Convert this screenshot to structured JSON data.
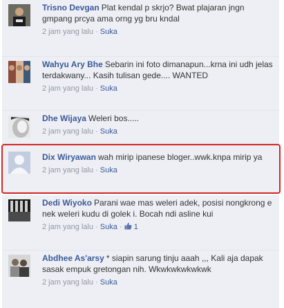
{
  "comments": [
    {
      "author": "Trisno Devgan",
      "text": "Plat kendal p skrjo? Bwat plajaran jngn gmpang prcya ama orng yg bru kndal",
      "time": "2 jam yang lalu",
      "separator": "·",
      "like_label": "Suka"
    },
    {
      "author": "Wahyu Ary Bhe",
      "text": "Sebarin ini foto dimanapun...krna ini udh jelas terdakwany... Kasih tulisan gede.... WANTED",
      "time": "2 jam yang lalu",
      "separator": "·",
      "like_label": "Suka"
    },
    {
      "author": "Dhe Wijaya",
      "text": "Weleri bos.....",
      "time": "2 jam yang lalu",
      "separator": "·",
      "like_label": "Suka"
    },
    {
      "author": "Dix Wiryawan",
      "text": "wah mirip ipanese bloger..wwk.knpa mirip ya",
      "time": "2 jam yang lalu",
      "separator": "·",
      "like_label": "Suka"
    },
    {
      "author": "Dedi Wiyoko",
      "text": "Parani wae mas weleri adek, posisi nongkrong e nek weleri kudu di golek i. Bocah ndi asline kui",
      "time": "2 jam yang lalu",
      "separator": "·",
      "like_label": "Suka",
      "likes": "1"
    },
    {
      "author": "Abdhee As'arsy",
      "text": "* siapin sarung tinju aaah ,,, Kali aja dapak sasak empuk gretongan nih. Wkwkwkwkwkwk",
      "time": "2 jam yang lalu",
      "separator": "·",
      "like_label": "Suka"
    }
  ]
}
